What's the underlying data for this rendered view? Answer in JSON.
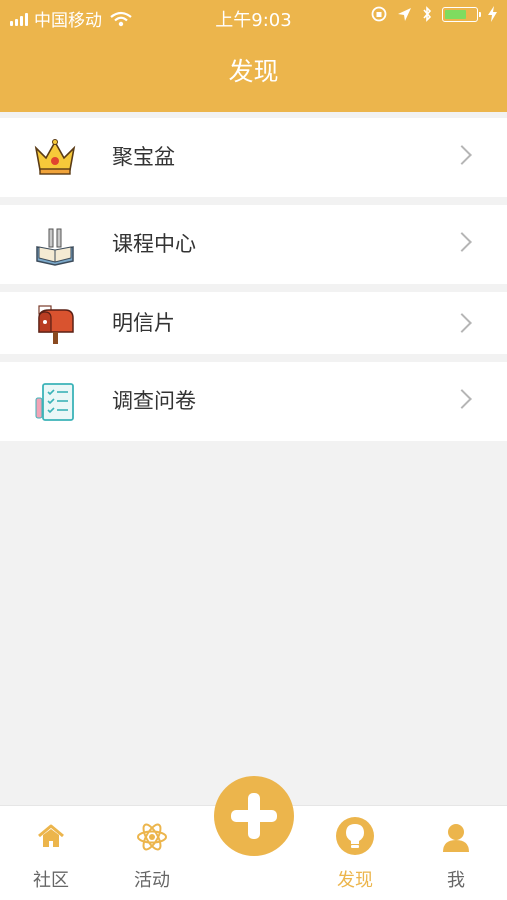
{
  "status_bar": {
    "carrier": "中国移动",
    "time": "上午9:03"
  },
  "header": {
    "title": "发现"
  },
  "menu": {
    "items": [
      {
        "label": "聚宝盆",
        "icon": "crown-icon"
      },
      {
        "label": "课程中心",
        "icon": "book-icon"
      },
      {
        "label": "明信片",
        "icon": "mailbox-icon"
      },
      {
        "label": "调查问卷",
        "icon": "checklist-icon"
      }
    ]
  },
  "tabbar": {
    "tabs": [
      {
        "label": "社区",
        "icon": "home-icon"
      },
      {
        "label": "活动",
        "icon": "atom-icon"
      },
      {
        "label": "发现",
        "icon": "lightbulb-icon",
        "active": true
      },
      {
        "label": "我",
        "icon": "user-icon"
      }
    ],
    "fab_icon": "plus-icon"
  },
  "colors": {
    "accent": "#ecb54c",
    "background": "#f2f2f2"
  }
}
